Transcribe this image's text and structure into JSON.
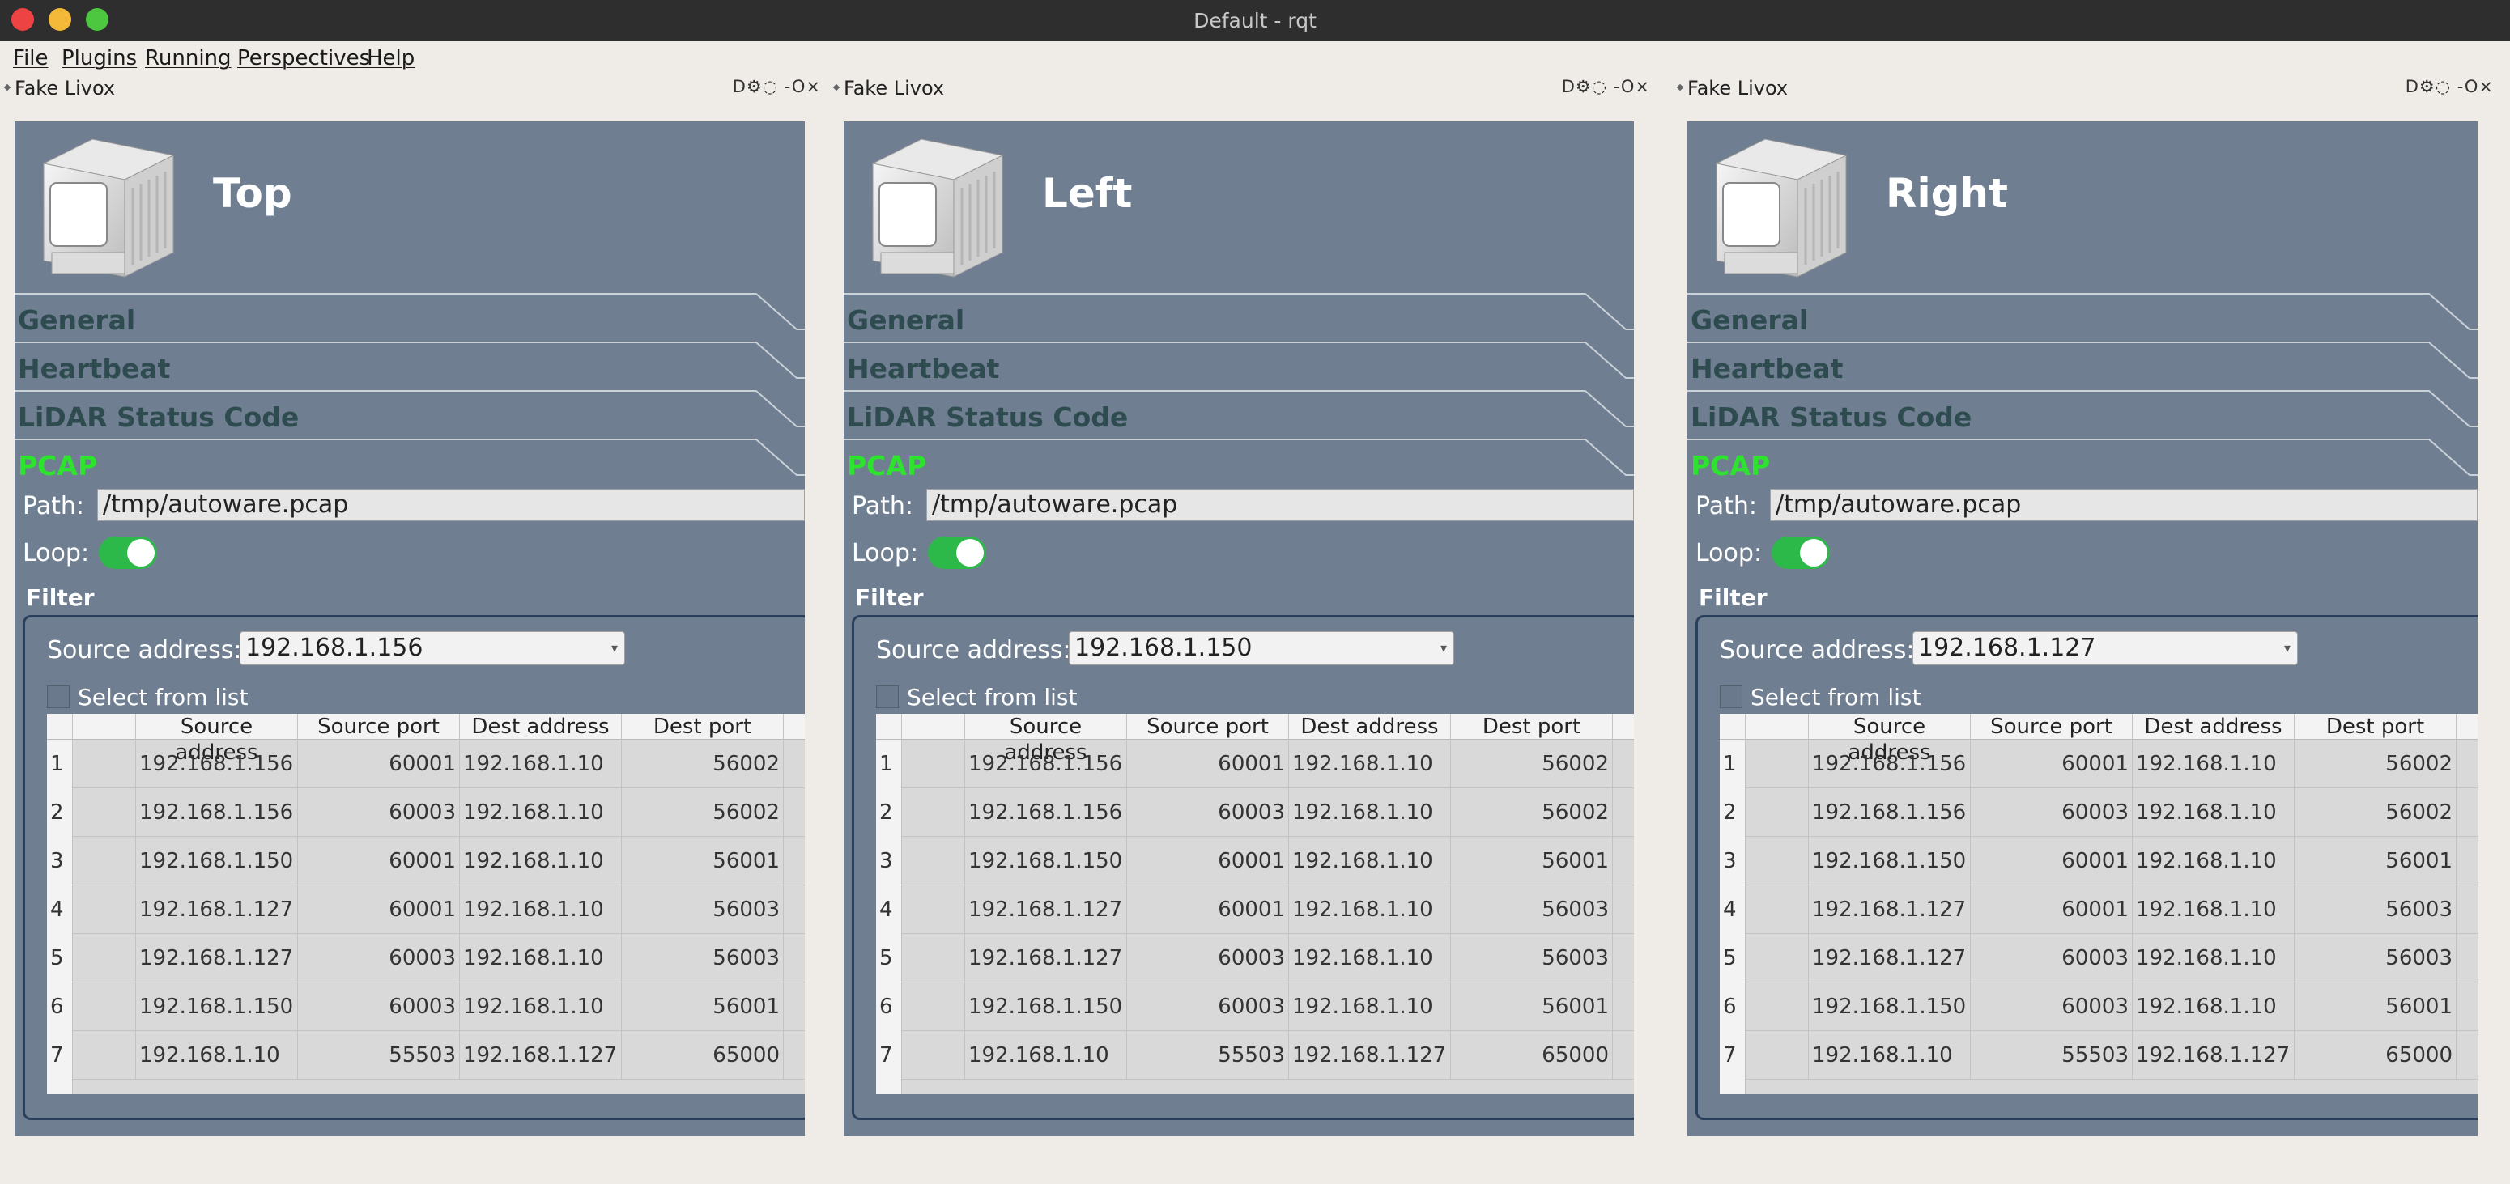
{
  "window": {
    "title": "Default - rqt"
  },
  "menu": [
    "File",
    "Plugins",
    "Running",
    "Perspectives",
    "Help"
  ],
  "panels": [
    {
      "dock_title": "Fake Livox",
      "dock_buttons": "D⚙◌ -O×",
      "name": "Top",
      "sections": [
        "General",
        "Heartbeat",
        "LiDAR Status Code",
        "PCAP"
      ],
      "path_label": "Path:",
      "path_value": "/tmp/autoware.pcap",
      "loop_label": "Loop:",
      "filter_label": "Filter",
      "source_label": "Source address:",
      "source_value": "192.168.1.156",
      "select_from_list": "Select from list",
      "columns": [
        "Source address",
        "Source port",
        "Dest address",
        "Dest port"
      ],
      "rows": [
        [
          "1",
          "192.168.1.156",
          "60001",
          "192.168.1.10",
          "56002"
        ],
        [
          "2",
          "192.168.1.156",
          "60003",
          "192.168.1.10",
          "56002"
        ],
        [
          "3",
          "192.168.1.150",
          "60001",
          "192.168.1.10",
          "56001"
        ],
        [
          "4",
          "192.168.1.127",
          "60001",
          "192.168.1.10",
          "56003"
        ],
        [
          "5",
          "192.168.1.127",
          "60003",
          "192.168.1.10",
          "56003"
        ],
        [
          "6",
          "192.168.1.150",
          "60003",
          "192.168.1.10",
          "56001"
        ],
        [
          "7",
          "192.168.1.10",
          "55503",
          "192.168.1.127",
          "65000"
        ]
      ]
    },
    {
      "dock_title": "Fake Livox",
      "dock_buttons": "D⚙◌ -O×",
      "name": "Left",
      "sections": [
        "General",
        "Heartbeat",
        "LiDAR Status Code",
        "PCAP"
      ],
      "path_label": "Path:",
      "path_value": "/tmp/autoware.pcap",
      "loop_label": "Loop:",
      "filter_label": "Filter",
      "source_label": "Source address:",
      "source_value": "192.168.1.150",
      "select_from_list": "Select from list",
      "columns": [
        "Source address",
        "Source port",
        "Dest address",
        "Dest port"
      ],
      "rows": [
        [
          "1",
          "192.168.1.156",
          "60001",
          "192.168.1.10",
          "56002"
        ],
        [
          "2",
          "192.168.1.156",
          "60003",
          "192.168.1.10",
          "56002"
        ],
        [
          "3",
          "192.168.1.150",
          "60001",
          "192.168.1.10",
          "56001"
        ],
        [
          "4",
          "192.168.1.127",
          "60001",
          "192.168.1.10",
          "56003"
        ],
        [
          "5",
          "192.168.1.127",
          "60003",
          "192.168.1.10",
          "56003"
        ],
        [
          "6",
          "192.168.1.150",
          "60003",
          "192.168.1.10",
          "56001"
        ],
        [
          "7",
          "192.168.1.10",
          "55503",
          "192.168.1.127",
          "65000"
        ]
      ]
    },
    {
      "dock_title": "Fake Livox",
      "dock_buttons": "D⚙◌ -O×",
      "name": "Right",
      "sections": [
        "General",
        "Heartbeat",
        "LiDAR Status Code",
        "PCAP"
      ],
      "path_label": "Path:",
      "path_value": "/tmp/autoware.pcap",
      "loop_label": "Loop:",
      "filter_label": "Filter",
      "source_label": "Source address:",
      "source_value": "192.168.1.127",
      "select_from_list": "Select from list",
      "columns": [
        "Source address",
        "Source port",
        "Dest address",
        "Dest port"
      ],
      "rows": [
        [
          "1",
          "192.168.1.156",
          "60001",
          "192.168.1.10",
          "56002"
        ],
        [
          "2",
          "192.168.1.156",
          "60003",
          "192.168.1.10",
          "56002"
        ],
        [
          "3",
          "192.168.1.150",
          "60001",
          "192.168.1.10",
          "56001"
        ],
        [
          "4",
          "192.168.1.127",
          "60001",
          "192.168.1.10",
          "56003"
        ],
        [
          "5",
          "192.168.1.127",
          "60003",
          "192.168.1.10",
          "56003"
        ],
        [
          "6",
          "192.168.1.150",
          "60003",
          "192.168.1.10",
          "56001"
        ],
        [
          "7",
          "192.168.1.10",
          "55503",
          "192.168.1.127",
          "65000"
        ]
      ]
    }
  ],
  "colors": {
    "panel_bg": "#6f7f91",
    "active_section": "#2ee32e",
    "inactive_section": "#2e4b4f",
    "toggle_on": "#2db84a"
  },
  "toggles": {
    "loop_enabled": true
  }
}
